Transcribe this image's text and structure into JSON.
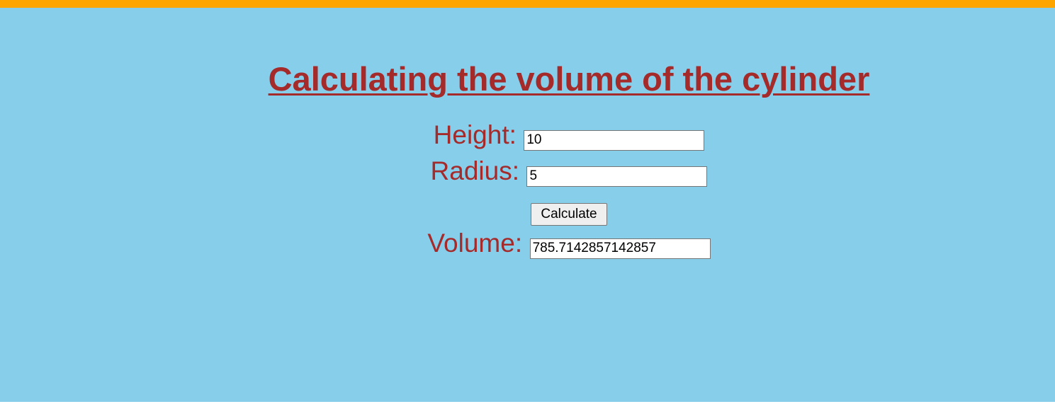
{
  "page": {
    "title": "Calculating the volume of the cylinder"
  },
  "form": {
    "height_label": "Height:",
    "height_value": "10",
    "radius_label": "Radius:",
    "radius_value": "5",
    "calculate_label": "Calculate",
    "volume_label": "Volume:",
    "volume_value": "785.7142857142857"
  },
  "colors": {
    "background": "#87ceeb",
    "top_bar": "#ffa500",
    "text": "#a52a2a"
  }
}
